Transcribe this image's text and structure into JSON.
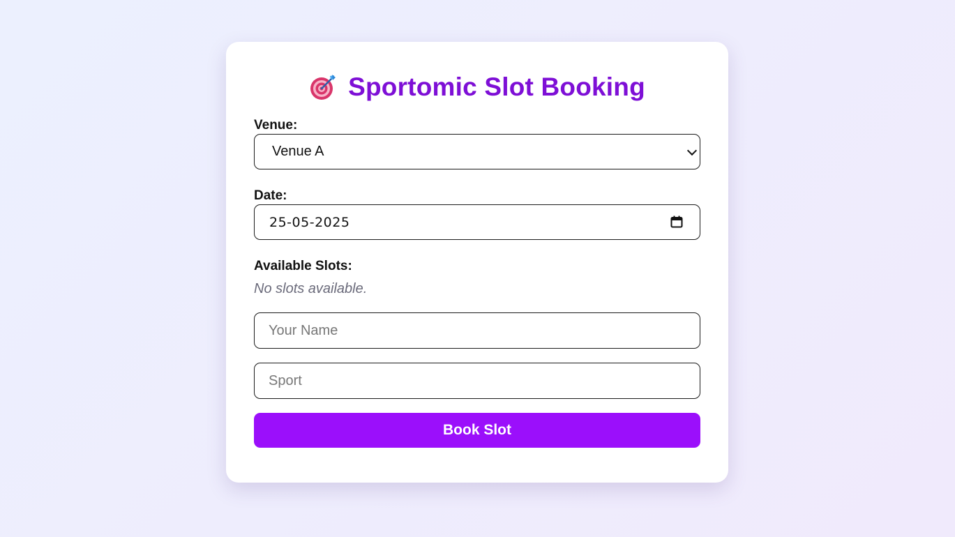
{
  "header": {
    "title": "Sportomic Slot Booking",
    "icon": "target-dart-icon",
    "title_color": "#7e0fd6"
  },
  "form": {
    "venue": {
      "label": "Venue:",
      "selected": "Venue A"
    },
    "date": {
      "label": "Date:",
      "value": "25-05-2025"
    },
    "slots": {
      "label": "Available Slots:",
      "empty_message": "No slots available."
    },
    "name_input": {
      "placeholder": "Your Name"
    },
    "sport_input": {
      "placeholder": "Sport"
    },
    "submit": {
      "label": "Book Slot",
      "color": "#9b0ffb"
    }
  }
}
